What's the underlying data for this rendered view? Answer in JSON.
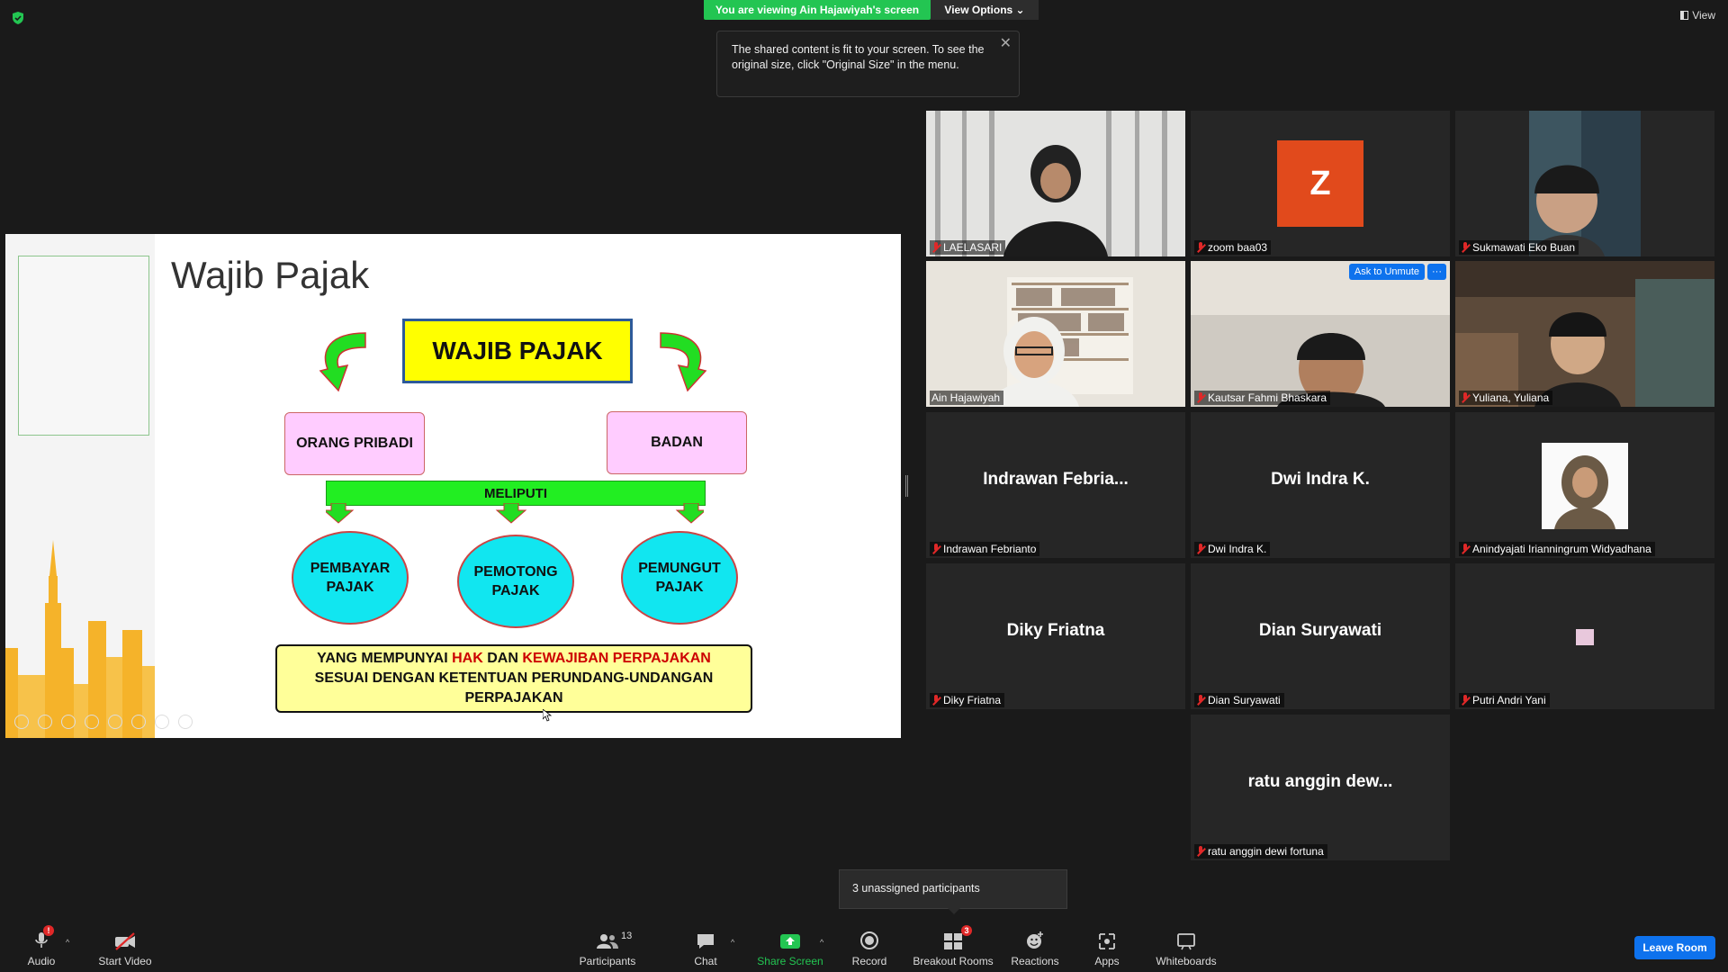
{
  "banner": {
    "text": "You are viewing Ain Hajawiyah's screen",
    "view_options": "View Options ⌄"
  },
  "tooltip": {
    "text": "The shared content is fit to your screen. To see the original size, click \"Original Size\" in the menu."
  },
  "view_button": "View",
  "slide": {
    "title": "Wajib Pajak",
    "main_box": "WAJIB PAJAK",
    "left_box": "ORANG PRIBADI",
    "right_box": "BADAN",
    "bar": "MELIPUTI",
    "circles": [
      "PEMBAYAR PAJAK",
      "PEMOTONG PAJAK",
      "PEMUNGUT PAJAK"
    ],
    "note_part1": "YANG MEMPUNYAI ",
    "note_hak": "HAK",
    "note_dan": " DAN ",
    "note_kewajiban": "KEWAJIBAN PERPAJAKAN",
    "note_line2": "SESUAI DENGAN KETENTUAN PERUNDANG-UNDANGAN",
    "note_line3": "PERPAJAKAN"
  },
  "participants": [
    {
      "label": "LAELASARI"
    },
    {
      "label": "zoom baa03",
      "avatar": "Z"
    },
    {
      "label": "Sukmawati Eko Buan"
    },
    {
      "label": "Ain Hajawiyah"
    },
    {
      "label": "Kautsar Fahmi Bhaskara"
    },
    {
      "label": "Yuliana, Yuliana"
    },
    {
      "label": "Indrawan Febrianto",
      "display": "Indrawan Febria..."
    },
    {
      "label": "Dwi Indra K.",
      "display": "Dwi Indra K."
    },
    {
      "label": "Anindyajati Irianningrum Widyadhana"
    },
    {
      "label": "Diky Friatna",
      "display": "Diky Friatna"
    },
    {
      "label": "Dian Suryawati",
      "display": "Dian Suryawati"
    },
    {
      "label": "Putri Andri Yani"
    },
    {
      "label": "ratu anggin dewi fortuna",
      "display": "ratu anggin dew..."
    }
  ],
  "tile_actions": {
    "ask_to_unmute": "Ask to Unmute",
    "more": "···"
  },
  "unassigned": "3 unassigned participants",
  "toolbar": {
    "audio": "Audio",
    "audio_badge": "!",
    "start_video": "Start Video",
    "participants": "Participants",
    "participants_count": "13",
    "chat": "Chat",
    "share_screen": "Share Screen",
    "record": "Record",
    "breakout_rooms": "Breakout Rooms",
    "breakout_badge": "3",
    "reactions": "Reactions",
    "apps": "Apps",
    "whiteboards": "Whiteboards",
    "leave": "Leave Room"
  },
  "colors": {
    "accent_green": "#23c552",
    "zoom_blue": "#0e72ed",
    "active_speaker": "#e6ee5a",
    "muted_red": "#e02828"
  }
}
